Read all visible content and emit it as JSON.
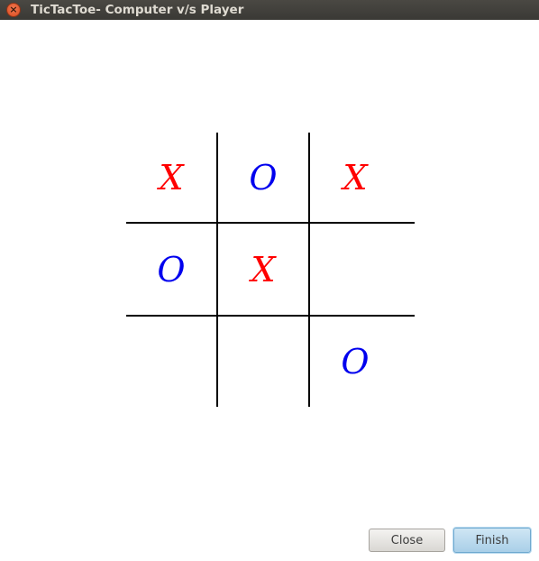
{
  "window": {
    "title": "TicTacToe- Computer v/s Player",
    "close_glyph": "×"
  },
  "board": {
    "cells": [
      "X",
      "O",
      "X",
      "O",
      "X",
      "",
      "",
      "",
      "O"
    ],
    "colors": {
      "X": "#ff0000",
      "O": "#0000ee"
    }
  },
  "buttons": {
    "close_label": "Close",
    "finish_label": "Finish"
  }
}
